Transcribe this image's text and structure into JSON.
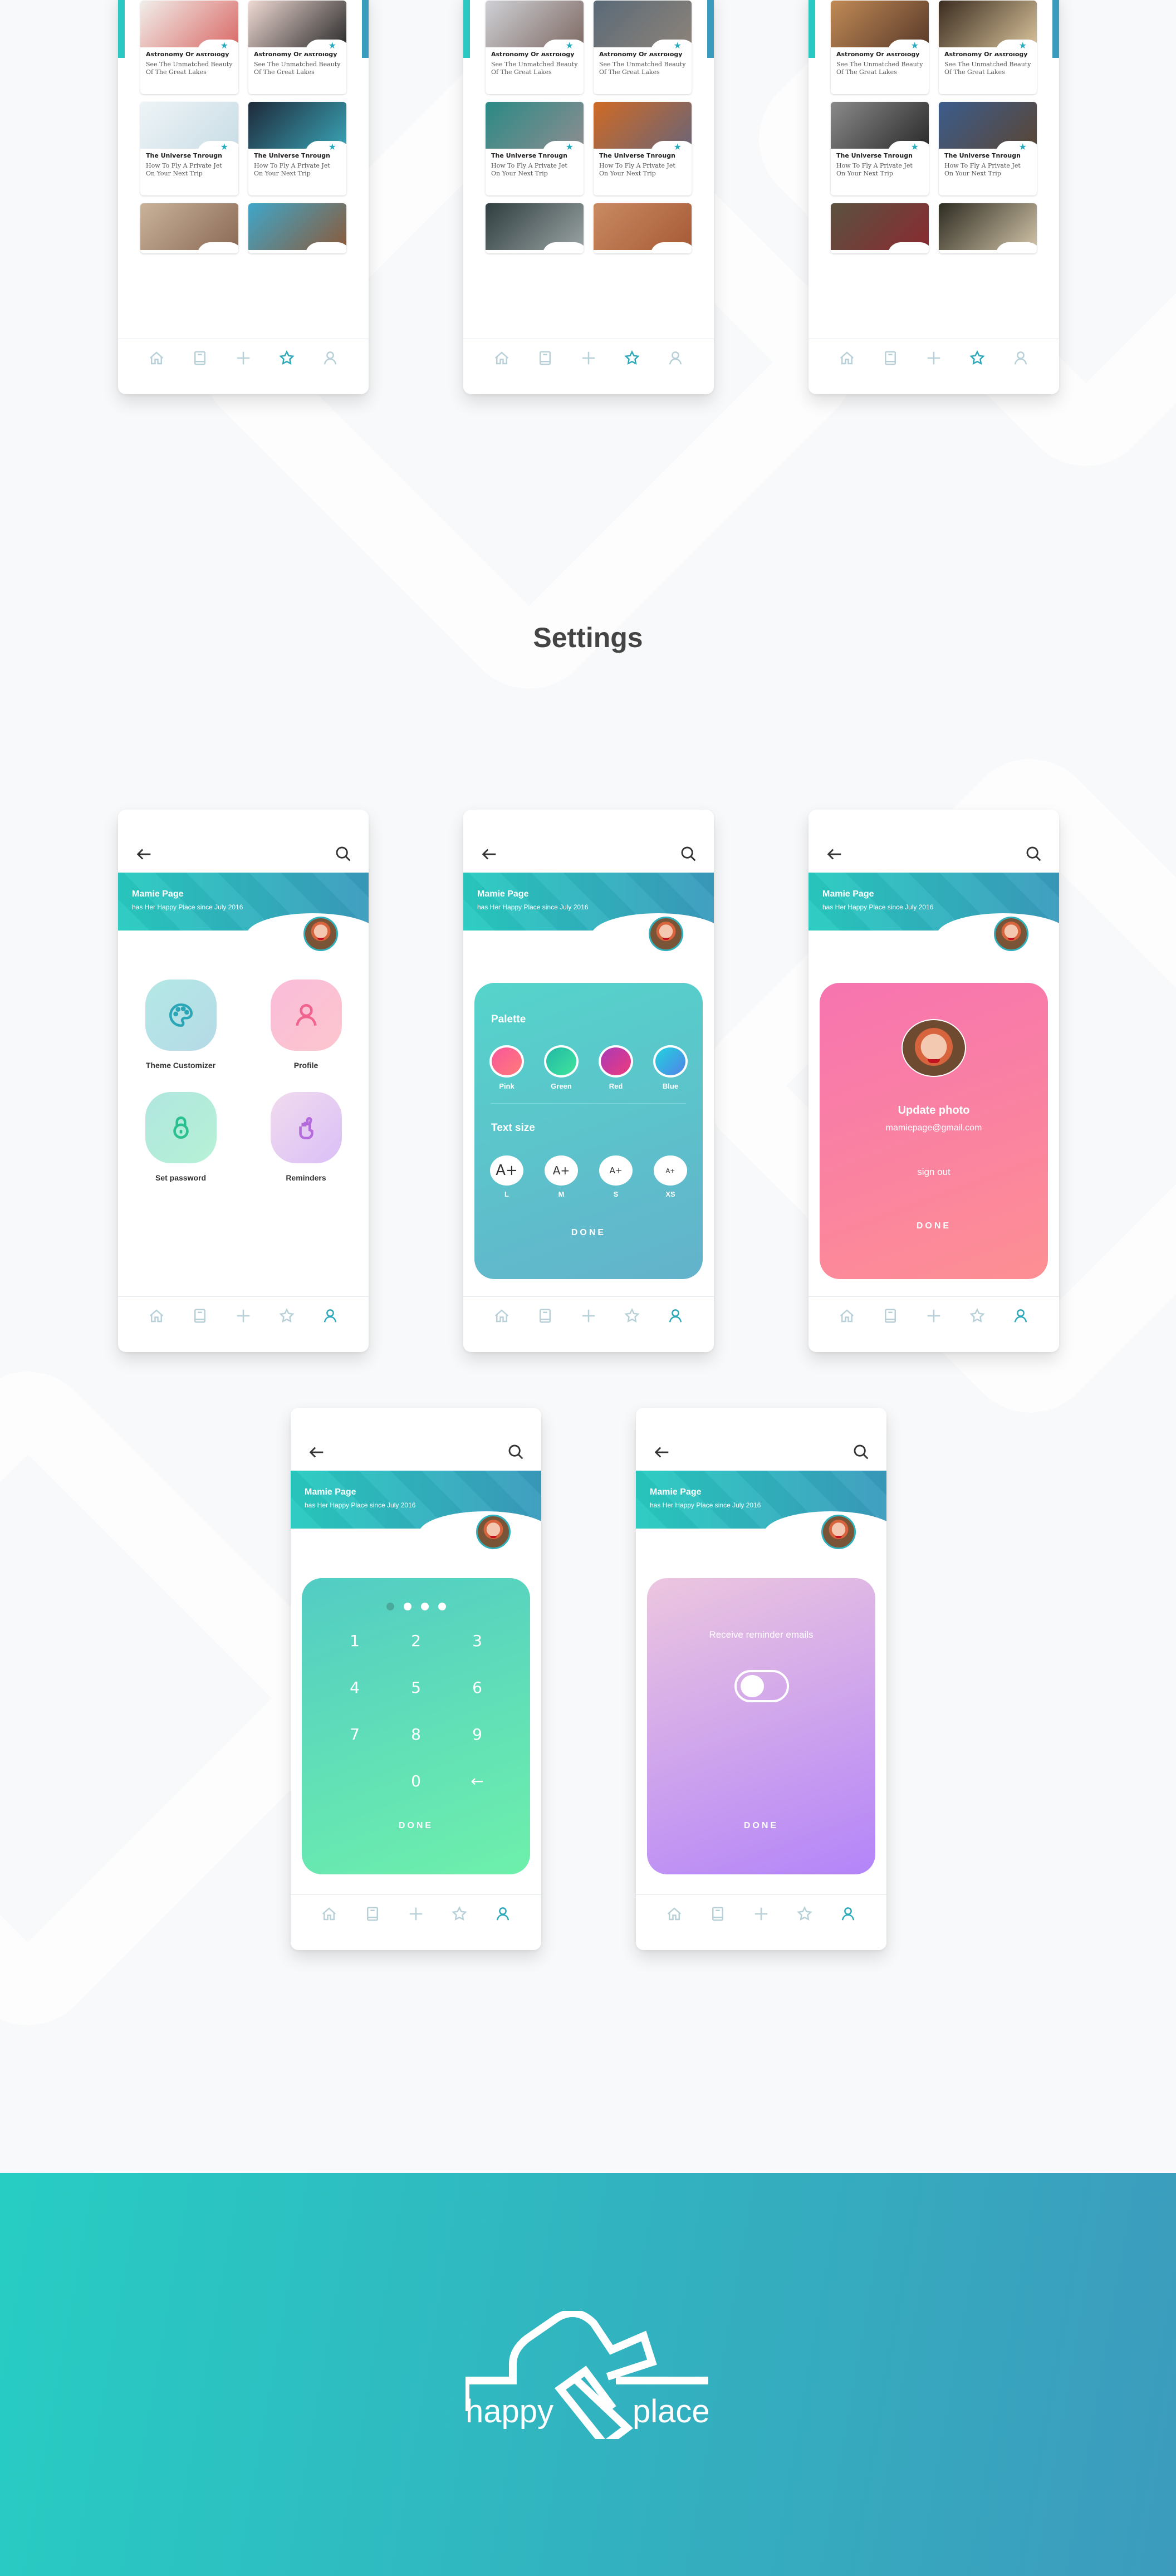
{
  "favorites_screens": [
    {
      "cards": [
        {
          "title": "Astronomy Or Astrology",
          "body": "See The Unmatched Beauty Of The Great Lakes",
          "image": "strawberry-desserts",
          "colors": [
            "#f1eeea",
            "#d96a67"
          ]
        },
        {
          "title": "Astronomy Or Astrology",
          "body": "See The Unmatched Beauty Of The Great Lakes",
          "image": "headphones",
          "colors": [
            "#efd9d3",
            "#2a2a2a"
          ]
        },
        {
          "title": "The Universe Through",
          "body": "How To Fly A Private Jet On Your Next Trip",
          "image": "drone",
          "colors": [
            "#eef4f7",
            "#c9dde6"
          ]
        },
        {
          "title": "The Universe Through",
          "body": "How To Fly A Private Jet On Your Next Trip",
          "image": "city-night",
          "colors": [
            "#1e2a3a",
            "#39a3b5"
          ]
        },
        {
          "title": "",
          "body": "",
          "image": "wood-flowers",
          "colors": [
            "#c9b29a",
            "#8b6a55"
          ]
        },
        {
          "title": "",
          "body": "",
          "image": "coastal-town",
          "colors": [
            "#3fa6c9",
            "#8b5a3a"
          ]
        }
      ]
    },
    {
      "cards": [
        {
          "title": "Astronomy Or Astrology",
          "body": "See The Unmatched Beauty Of The Great Lakes",
          "image": "foggy-city",
          "colors": [
            "#cfd1d6",
            "#7f6a64"
          ]
        },
        {
          "title": "Astronomy Or Astrology",
          "body": "See The Unmatched Beauty Of The Great Lakes",
          "image": "pyramid-clouds",
          "colors": [
            "#5a6a78",
            "#8d8379"
          ]
        },
        {
          "title": "The Universe Through",
          "body": "How To Fly A Private Jet On Your Next Trip",
          "image": "river-kayak",
          "colors": [
            "#2a8a85",
            "#8d8c90"
          ]
        },
        {
          "title": "The Universe Through",
          "body": "How To Fly A Private Jet On Your Next Trip",
          "image": "plane-window",
          "colors": [
            "#cf6a25",
            "#6b6476"
          ]
        },
        {
          "title": "",
          "body": "",
          "image": "towers",
          "colors": [
            "#2f3e40",
            "#9aa3a3"
          ]
        },
        {
          "title": "",
          "body": "",
          "image": "dome-city",
          "colors": [
            "#c98a62",
            "#a65a36"
          ]
        }
      ]
    },
    {
      "cards": [
        {
          "title": "Astronomy Or Astrology",
          "body": "See The Unmatched Beauty Of The Great Lakes",
          "image": "shoes-rug",
          "colors": [
            "#c08a55",
            "#5a3a2a"
          ]
        },
        {
          "title": "Astronomy Or Astrology",
          "body": "See The Unmatched Beauty Of The Great Lakes",
          "image": "clothes-rack",
          "colors": [
            "#3a2c20",
            "#d8c29a"
          ]
        },
        {
          "title": "The Universe Through",
          "body": "How To Fly A Private Jet On Your Next Trip",
          "image": "notebook-watch",
          "colors": [
            "#8a8a8a",
            "#2a2a2a"
          ]
        },
        {
          "title": "The Universe Through",
          "body": "How To Fly A Private Jet On Your Next Trip",
          "image": "boot-shelf",
          "colors": [
            "#3c5c8c",
            "#5a4636"
          ]
        },
        {
          "title": "",
          "body": "",
          "image": "backpack-rocks",
          "colors": [
            "#5a5240",
            "#8a2a30"
          ]
        },
        {
          "title": "",
          "body": "",
          "image": "heels",
          "colors": [
            "#2e2c22",
            "#d2c4a8"
          ]
        }
      ]
    }
  ],
  "tabbar": {
    "items": [
      {
        "name": "home",
        "icon": "home-icon"
      },
      {
        "name": "library",
        "icon": "book-icon"
      },
      {
        "name": "add",
        "icon": "plus-icon"
      },
      {
        "name": "favorites",
        "icon": "star-icon"
      },
      {
        "name": "profile",
        "icon": "user-icon"
      }
    ],
    "active_color": "#2aa9bb",
    "inactive_color": "#b8d0d8"
  },
  "section_title": "Settings",
  "profile": {
    "name": "Mamie Page",
    "since": "has Her Happy Place since July 2016",
    "email": "mamiepage@gmail.com"
  },
  "settings_menu": {
    "items": [
      {
        "label": "Theme Customizer",
        "icon": "palette-icon",
        "bg": [
          "#b4e8e6",
          "#b5dae6"
        ],
        "stroke": "#2aa6b6"
      },
      {
        "label": "Profile",
        "icon": "user-icon",
        "bg": [
          "#f9bdda",
          "#fdc5cd"
        ],
        "stroke": "#f0648f"
      },
      {
        "label": "Set password",
        "icon": "lock-icon",
        "bg": [
          "#b0e6e0",
          "#b7f1d5"
        ],
        "stroke": "#2ac08f"
      },
      {
        "label": "Reminders",
        "icon": "fingers-crossed-icon",
        "bg": [
          "#f1dbee",
          "#dabff7"
        ],
        "stroke": "#b46cdc"
      }
    ]
  },
  "theme_customizer": {
    "palette_label": "Palette",
    "palette": [
      {
        "label": "Pink",
        "colors": [
          "#f9579b",
          "#ff7a78"
        ]
      },
      {
        "label": "Green",
        "colors": [
          "#21b8a6",
          "#40e49c"
        ]
      },
      {
        "label": "Red",
        "colors": [
          "#a83ab7",
          "#ee3b7d"
        ]
      },
      {
        "label": "Blue",
        "colors": [
          "#21d4de",
          "#5181e8"
        ]
      }
    ],
    "text_size_label": "Text size",
    "text_sizes": [
      {
        "label": "L",
        "glyph": "A+"
      },
      {
        "label": "M",
        "glyph": "A+"
      },
      {
        "label": "S",
        "glyph": "A+"
      },
      {
        "label": "XS",
        "glyph": "A+"
      }
    ],
    "done": "DONE"
  },
  "profile_panel": {
    "update_photo": "Update photo",
    "sign_out": "sign out",
    "done": "DONE"
  },
  "password_panel": {
    "pin_length": 4,
    "pin_filled": 1,
    "keys": [
      "1",
      "2",
      "3",
      "4",
      "5",
      "6",
      "7",
      "8",
      "9",
      "",
      "0",
      "←"
    ],
    "done": "DONE"
  },
  "reminder_panel": {
    "label": "Receive reminder emails",
    "enabled": false,
    "done": "DONE"
  },
  "brand": {
    "word1": "happy",
    "word2": "place",
    "footer_gradient": [
      "#27cdc3",
      "#3c9bbd"
    ]
  }
}
